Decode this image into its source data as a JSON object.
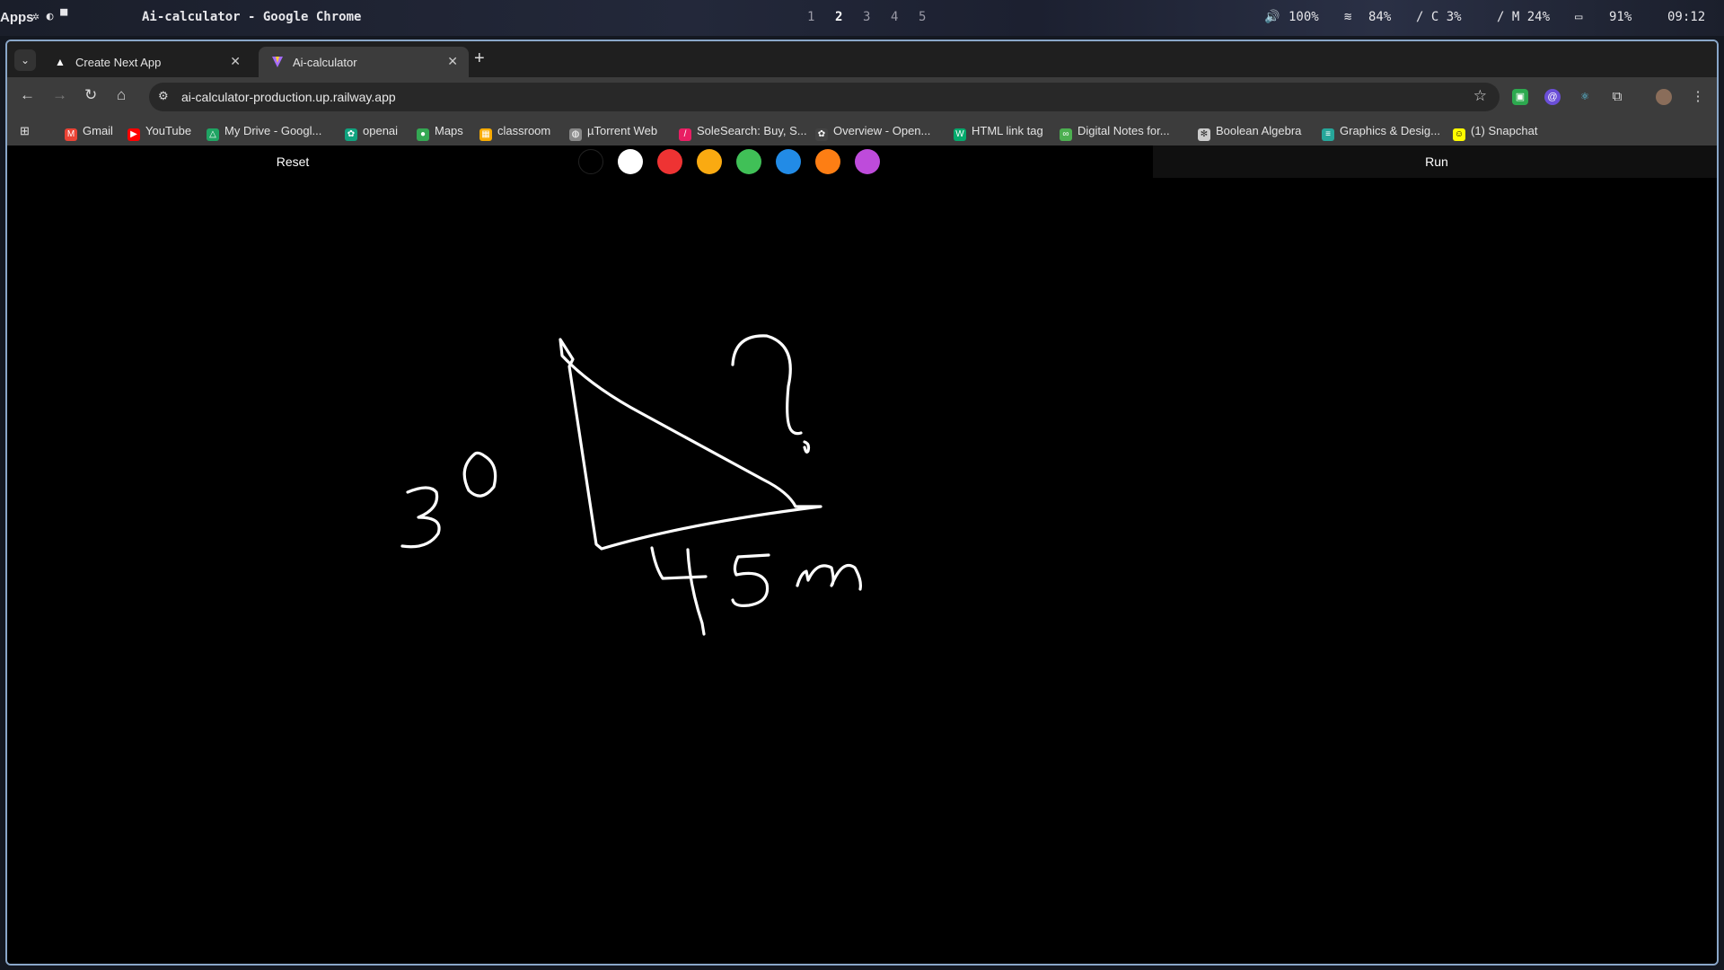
{
  "system_bar": {
    "apps_label": "Apps",
    "window_title": "Ai-calculator - Google Chrome",
    "workspaces": [
      "1",
      "2",
      "3",
      "4",
      "5"
    ],
    "active_workspace": "2",
    "volume": "100%",
    "wifi": "84%",
    "cpu": "/ C 3%",
    "mem": "/ M 24%",
    "battery": "91%",
    "clock": "09:12"
  },
  "tabs": [
    {
      "label": "Create Next App",
      "icon": "vercel-triangle-icon",
      "active": false
    },
    {
      "label": "Ai-calculator",
      "icon": "vite-icon",
      "active": true
    }
  ],
  "address_bar": {
    "url": "ai-calculator-production.up.railway.app"
  },
  "bookmarks": [
    {
      "label": "Gmail",
      "icon": "gmail-icon",
      "color": "#ea4335"
    },
    {
      "label": "YouTube",
      "icon": "youtube-icon",
      "color": "#ff0000"
    },
    {
      "label": "My Drive - Googl...",
      "icon": "drive-icon",
      "color": "#1fa463"
    },
    {
      "label": "openai",
      "icon": "openai-icon",
      "color": "#10a37f"
    },
    {
      "label": "Maps",
      "icon": "maps-icon",
      "color": "#34a853"
    },
    {
      "label": "classroom",
      "icon": "classroom-icon",
      "color": "#f9ab00"
    },
    {
      "label": "µTorrent Web",
      "icon": "globe-icon",
      "color": "#888888"
    },
    {
      "label": "SoleSearch: Buy, S...",
      "icon": "solesearch-icon",
      "color": "#e91e63"
    },
    {
      "label": "Overview - Open...",
      "icon": "openai-icon",
      "color": "#444444"
    },
    {
      "label": "HTML link tag",
      "icon": "w3-icon",
      "color": "#04aa6d"
    },
    {
      "label": "Digital Notes for...",
      "icon": "notes-icon",
      "color": "#4caf50"
    },
    {
      "label": "Boolean Algebra",
      "icon": "boolean-icon",
      "color": "#cccccc"
    },
    {
      "label": "Graphics & Desig...",
      "icon": "graphics-icon",
      "color": "#26a69a"
    },
    {
      "label": "(1) Snapchat",
      "icon": "snapchat-icon",
      "color": "#fffc00"
    }
  ],
  "app": {
    "reset_label": "Reset",
    "run_label": "Run",
    "colors": [
      "#000000",
      "#ffffff",
      "#ee3333",
      "#faaa11",
      "#40c057",
      "#228be6",
      "#fd7e14",
      "#be4bdb"
    ]
  }
}
